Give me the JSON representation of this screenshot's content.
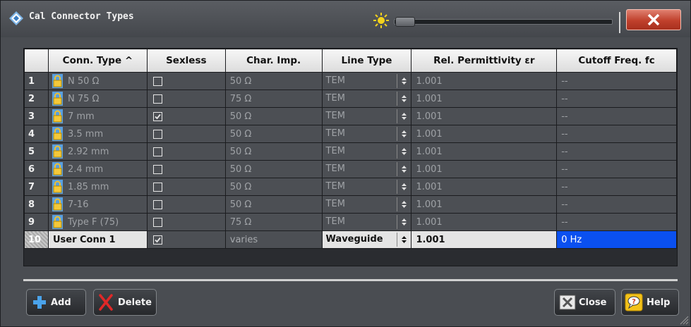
{
  "window": {
    "title": "Cal Connector Types"
  },
  "columns": [
    "Conn. Type ^",
    "Sexless",
    "Char. Imp.",
    "Line Type",
    "Rel. Permittivity εr",
    "Cutoff Freq. fc"
  ],
  "rows": [
    {
      "idx": "1",
      "name": "N 50 Ω",
      "sexless": false,
      "char": "50 Ω",
      "line": "TEM",
      "perm": "1.001",
      "cutoff": "--"
    },
    {
      "idx": "2",
      "name": "N 75 Ω",
      "sexless": false,
      "char": "75 Ω",
      "line": "TEM",
      "perm": "1.001",
      "cutoff": "--"
    },
    {
      "idx": "3",
      "name": "7 mm",
      "sexless": true,
      "char": "50 Ω",
      "line": "TEM",
      "perm": "1.001",
      "cutoff": "--"
    },
    {
      "idx": "4",
      "name": "3.5 mm",
      "sexless": false,
      "char": "50 Ω",
      "line": "TEM",
      "perm": "1.001",
      "cutoff": "--"
    },
    {
      "idx": "5",
      "name": "2.92 mm",
      "sexless": false,
      "char": "50 Ω",
      "line": "TEM",
      "perm": "1.001",
      "cutoff": "--"
    },
    {
      "idx": "6",
      "name": "2.4 mm",
      "sexless": false,
      "char": "50 Ω",
      "line": "TEM",
      "perm": "1.001",
      "cutoff": "--"
    },
    {
      "idx": "7",
      "name": "1.85 mm",
      "sexless": false,
      "char": "50 Ω",
      "line": "TEM",
      "perm": "1.001",
      "cutoff": "--"
    },
    {
      "idx": "8",
      "name": "7-16",
      "sexless": false,
      "char": "50 Ω",
      "line": "TEM",
      "perm": "1.001",
      "cutoff": "--"
    },
    {
      "idx": "9",
      "name": "Type F (75)",
      "sexless": false,
      "char": "75 Ω",
      "line": "TEM",
      "perm": "1.001",
      "cutoff": "--"
    },
    {
      "idx": "10",
      "name": "User Conn 1",
      "sexless": true,
      "char": "varies",
      "line": "Waveguide",
      "perm": "1.001",
      "cutoff": "0 Hz"
    }
  ],
  "buttons": {
    "add": "Add",
    "delete": "Delete",
    "close": "Close",
    "help": "Help"
  }
}
